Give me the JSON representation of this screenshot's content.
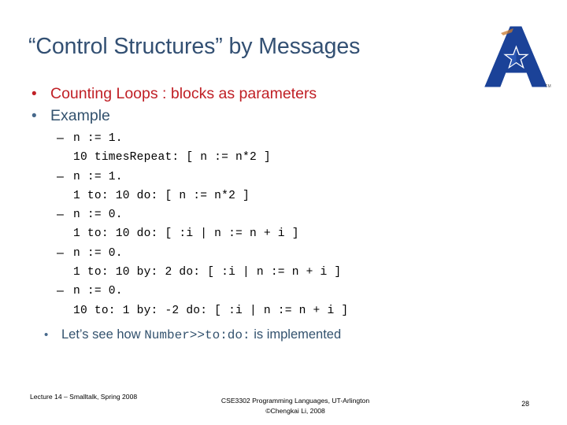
{
  "slide": {
    "title": "“Control Structures” by Messages",
    "logo": {
      "name": "ut-arlington-logo",
      "trademark": "TM",
      "color": "#1B4298"
    },
    "colors": {
      "title": "#335073",
      "accent_red": "#C02026",
      "accent_blue": "#33526E",
      "logo_blue": "#1B4298"
    },
    "bullets": [
      {
        "marker": "•",
        "text": "Counting Loops : blocks as parameters",
        "style": "red"
      },
      {
        "marker": "•",
        "text": "Example",
        "style": "blue"
      }
    ],
    "code_items": [
      {
        "dash": "–",
        "line1": "n := 1.",
        "line2": "10 timesRepeat: [ n := n*2 ]"
      },
      {
        "dash": "–",
        "line1": "n := 1.",
        "line2": "1 to: 10 do: [ n := n*2 ]"
      },
      {
        "dash": "–",
        "line1": "n := 0.",
        "line2": "1 to: 10 do: [ :i | n := n + i ]"
      },
      {
        "dash": "–",
        "line1": "n := 0.",
        "line2": "1 to: 10 by: 2 do: [ :i | n := n + i ]"
      },
      {
        "dash": "–",
        "line1": "n := 0.",
        "line2": "10 to: 1 by: -2 do: [ :i | n := n + i ]"
      }
    ],
    "closing": {
      "marker": "•",
      "prefix": "Let’s see how ",
      "code": "Number>>to:do:",
      "suffix": " is implemented"
    },
    "footer": {
      "left": "Lecture 14 – Smalltalk, Spring 2008",
      "center_line1": "CSE3302 Programming Languages, UT-Arlington",
      "center_line2": "©Chengkai Li, 2008",
      "page_number": "28"
    }
  }
}
